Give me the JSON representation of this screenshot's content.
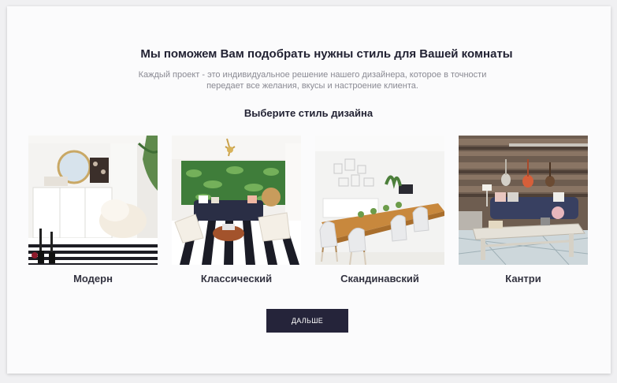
{
  "header": {
    "title": "Мы поможем Вам подобрать нужны стиль для Вашей комнаты",
    "subtitle_line1": "Каждый проект - это индивидуальное решение нашего дизайнера, которое в точности",
    "subtitle_line2": "передает все желания, вкусы и настроение клиента."
  },
  "choose_label": "Выберите стиль дизайна",
  "styles": [
    {
      "label": "Модерн",
      "image": "modern-room-photo"
    },
    {
      "label": "Классический",
      "image": "classic-room-photo"
    },
    {
      "label": "Скандинавский",
      "image": "scandinavian-room-photo"
    },
    {
      "label": "Кантри",
      "image": "country-room-photo"
    }
  ],
  "next_button": "Дальше",
  "colors": {
    "background": "#f0f0f2",
    "card": "#fbfbfc",
    "heading": "#222233",
    "muted_text": "#8a8a93",
    "button": "#25243a"
  }
}
